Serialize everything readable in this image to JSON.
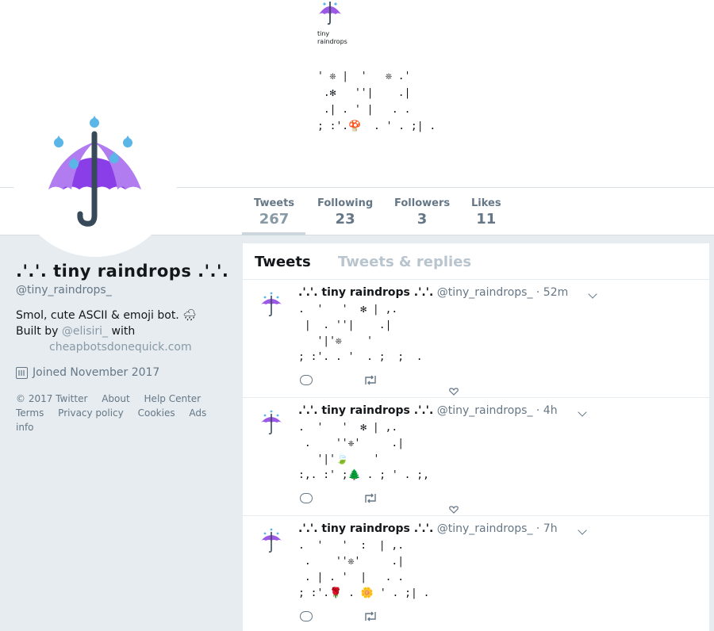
{
  "banner": {
    "logo_text": "tiny\nraindrops",
    "art": "' ❊ |  '   ❊ .'\n .✻   ''|    .|\n .| . ' |   . .\n; :'.🍄  . ' . ;| ."
  },
  "nav": {
    "stats": [
      {
        "label": "Tweets",
        "value": "267"
      },
      {
        "label": "Following",
        "value": "23"
      },
      {
        "label": "Followers",
        "value": "3"
      },
      {
        "label": "Likes",
        "value": "11"
      }
    ]
  },
  "profile": {
    "name": ".'.'. tiny raindrops .'.'.",
    "handle": "@tiny_raindrops_",
    "bio_text": "Smol, cute ASCII & emoji bot. 🌧",
    "bio_built_by": "Built by",
    "bio_mention": "@elisiri_",
    "bio_with": "with",
    "bio_site": "cheapbotsdonequick.com",
    "joined": "Joined November 2017"
  },
  "footer": {
    "line1": [
      "© 2017 Twitter",
      "About",
      "Help Center"
    ],
    "line2": [
      "Terms",
      "Privacy policy",
      "Cookies",
      "Ads info"
    ]
  },
  "tabs": {
    "tweets": "Tweets",
    "replies": "Tweets & replies"
  },
  "tweets": [
    {
      "name": ".'.'. tiny raindrops .'.'.",
      "handle": "@tiny_raindrops_",
      "time": "· 52m",
      "body": ".  '   '  ✻ | ,.\n |  . ''|    .|\n   '|'❊    '\n; :'. . '  . ;  ;  ."
    },
    {
      "name": ".'.'. tiny raindrops .'.'.",
      "handle": "@tiny_raindrops_",
      "time": "· 4h",
      "body": ".  '   '  ✻ | ,.\n .    ''❈'     .|\n   '|'🍃    '\n:,. :' ;🌲 . ; ' . ;,"
    },
    {
      "name": ".'.'. tiny raindrops .'.'.",
      "handle": "@tiny_raindrops_",
      "time": "· 7h",
      "body": ".  '   '  :  | ,.\n .    ''❊'     .|\n . | . '  |   . .\n; :'.🌹 . 🌼 ' . ;| ."
    }
  ],
  "colors": {
    "umbrella_purple": "#8a3ee8",
    "umbrella_light": "#b07cf0",
    "raindrop": "#5bb6e8",
    "handle_gray": "#384a5a"
  },
  "icons": {
    "reply": "reply-icon",
    "retweet": "retweet-icon",
    "like": "heart-icon",
    "calendar": "calendar-icon",
    "caret": "chevron-down-icon"
  }
}
